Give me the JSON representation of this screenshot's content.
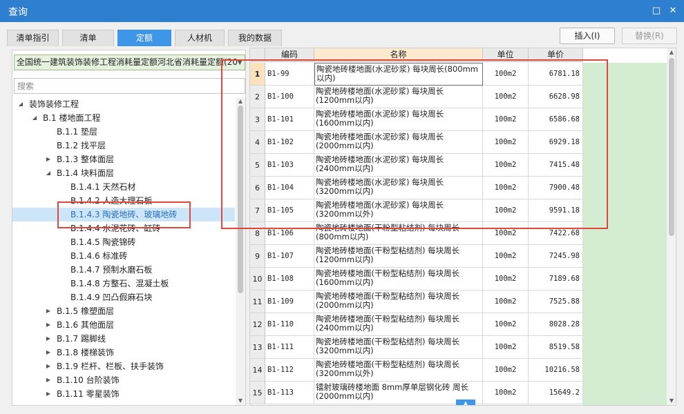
{
  "window": {
    "title": "查询"
  },
  "tabs": [
    {
      "label": "清单指引"
    },
    {
      "label": "清单"
    },
    {
      "label": "定额",
      "active": true
    },
    {
      "label": "人材机"
    },
    {
      "label": "我的数据"
    }
  ],
  "actions": {
    "insert_label": "插入(I)",
    "replace_label": "替换(R)"
  },
  "library": {
    "selected": "全国统一建筑装饰装修工程消耗量定额河北省消耗量定额(20"
  },
  "search": {
    "placeholder": "搜索"
  },
  "tree": [
    {
      "label": "装饰装修工程",
      "level": 0,
      "toggle": "expanded"
    },
    {
      "label": "B.1 楼地面工程",
      "level": 1,
      "toggle": "expanded"
    },
    {
      "label": "B.1.1 垫层",
      "level": 2,
      "toggle": "none"
    },
    {
      "label": "B.1.2 找平层",
      "level": 2,
      "toggle": "none"
    },
    {
      "label": "B.1.3 整体面层",
      "level": 2,
      "toggle": "collapsed"
    },
    {
      "label": "B.1.4 块料面层",
      "level": 2,
      "toggle": "expanded"
    },
    {
      "label": "B.1.4.1 天然石材",
      "level": 3,
      "toggle": "none"
    },
    {
      "label": "B.1.4.2 人造大理石板",
      "level": 3,
      "toggle": "none"
    },
    {
      "label": "B.1.4.3 陶瓷地砖、玻璃地砖",
      "level": 3,
      "toggle": "none",
      "selected": true
    },
    {
      "label": "B.1.4.4 水泥花砖、缸砖",
      "level": 3,
      "toggle": "none"
    },
    {
      "label": "B.1.4.5 陶瓷锦砖",
      "level": 3,
      "toggle": "none"
    },
    {
      "label": "B.1.4.6 标准砖",
      "level": 3,
      "toggle": "none"
    },
    {
      "label": "B.1.4.7 预制水磨石板",
      "level": 3,
      "toggle": "none"
    },
    {
      "label": "B.1.4.8 方整石、混凝土板",
      "level": 3,
      "toggle": "none"
    },
    {
      "label": "B.1.4.9 凹凸假麻石块",
      "level": 3,
      "toggle": "none"
    },
    {
      "label": "B.1.5 橡塑面层",
      "level": 2,
      "toggle": "collapsed"
    },
    {
      "label": "B.1.6 其他面层",
      "level": 2,
      "toggle": "collapsed"
    },
    {
      "label": "B.1.7 踢脚线",
      "level": 2,
      "toggle": "collapsed"
    },
    {
      "label": "B.1.8 楼梯装饰",
      "level": 2,
      "toggle": "collapsed"
    },
    {
      "label": "B.1.9 栏杆、栏板、扶手装饰",
      "level": 2,
      "toggle": "collapsed"
    },
    {
      "label": "B.1.10 台阶装饰",
      "level": 2,
      "toggle": "collapsed"
    },
    {
      "label": "B.1.11 零星装饰",
      "level": 2,
      "toggle": "collapsed"
    }
  ],
  "grid": {
    "headers": {
      "code": "编码",
      "name": "名称",
      "unit": "单位",
      "price": "单价"
    },
    "rows": [
      {
        "num": "1",
        "code": "B1-99",
        "name": "陶瓷地砖楼地面(水泥砂浆) 每块周长(800mm以内)",
        "unit": "100m2",
        "price": "6781.18"
      },
      {
        "num": "2",
        "code": "B1-100",
        "name": "陶瓷地砖楼地面(水泥砂浆) 每块周长(1200mm以内)",
        "unit": "100m2",
        "price": "6628.98"
      },
      {
        "num": "3",
        "code": "B1-101",
        "name": "陶瓷地砖楼地面(水泥砂浆) 每块周长(1600mm以内)",
        "unit": "100m2",
        "price": "6586.68"
      },
      {
        "num": "4",
        "code": "B1-102",
        "name": "陶瓷地砖楼地面(水泥砂浆) 每块周长(2000mm以内)",
        "unit": "100m2",
        "price": "6929.18"
      },
      {
        "num": "5",
        "code": "B1-103",
        "name": "陶瓷地砖楼地面(水泥砂浆) 每块周长(2400mm以内)",
        "unit": "100m2",
        "price": "7415.48"
      },
      {
        "num": "6",
        "code": "B1-104",
        "name": "陶瓷地砖楼地面(水泥砂浆) 每块周长(3200mm以内)",
        "unit": "100m2",
        "price": "7900.48"
      },
      {
        "num": "7",
        "code": "B1-105",
        "name": "陶瓷地砖楼地面(水泥砂浆) 每块周长(3200mm以外)",
        "unit": "100m2",
        "price": "9591.18"
      },
      {
        "num": "8",
        "code": "B1-106",
        "name": "陶瓷地砖楼地面(干粉型粘结剂) 每块周长(800mm以内)",
        "unit": "100m2",
        "price": "7422.68"
      },
      {
        "num": "9",
        "code": "B1-107",
        "name": "陶瓷地砖楼地面(干粉型粘结剂) 每块周长(1200mm以内)",
        "unit": "100m2",
        "price": "7245.98"
      },
      {
        "num": "10",
        "code": "B1-108",
        "name": "陶瓷地砖楼地面(干粉型粘结剂) 每块周长(1600mm以内)",
        "unit": "100m2",
        "price": "7189.68"
      },
      {
        "num": "11",
        "code": "B1-109",
        "name": "陶瓷地砖楼地面(干粉型粘结剂) 每块周长(2000mm以内)",
        "unit": "100m2",
        "price": "7525.88"
      },
      {
        "num": "12",
        "code": "B1-110",
        "name": "陶瓷地砖楼地面(干粉型粘结剂) 每块周长(2400mm以内)",
        "unit": "100m2",
        "price": "8028.28"
      },
      {
        "num": "13",
        "code": "B1-111",
        "name": "陶瓷地砖楼地面(干粉型粘结剂) 每块周长(3200mm以内)",
        "unit": "100m2",
        "price": "8519.58"
      },
      {
        "num": "14",
        "code": "B1-112",
        "name": "陶瓷地砖楼地面(干粉型粘结剂) 每块周长(3200mm以外)",
        "unit": "100m2",
        "price": "10216.58"
      },
      {
        "num": "15",
        "code": "B1-113",
        "name": "镭射玻璃砖楼地面 8mm厚单层钢化砖 周长(2000mm以内)",
        "unit": "100m2",
        "price": "15649.2"
      }
    ]
  },
  "colors": {
    "titlebar": "#2f7fd0",
    "active_tab": "#3e96e8",
    "highlight": "#e0443b",
    "price_fill": "#d4ecd1"
  }
}
